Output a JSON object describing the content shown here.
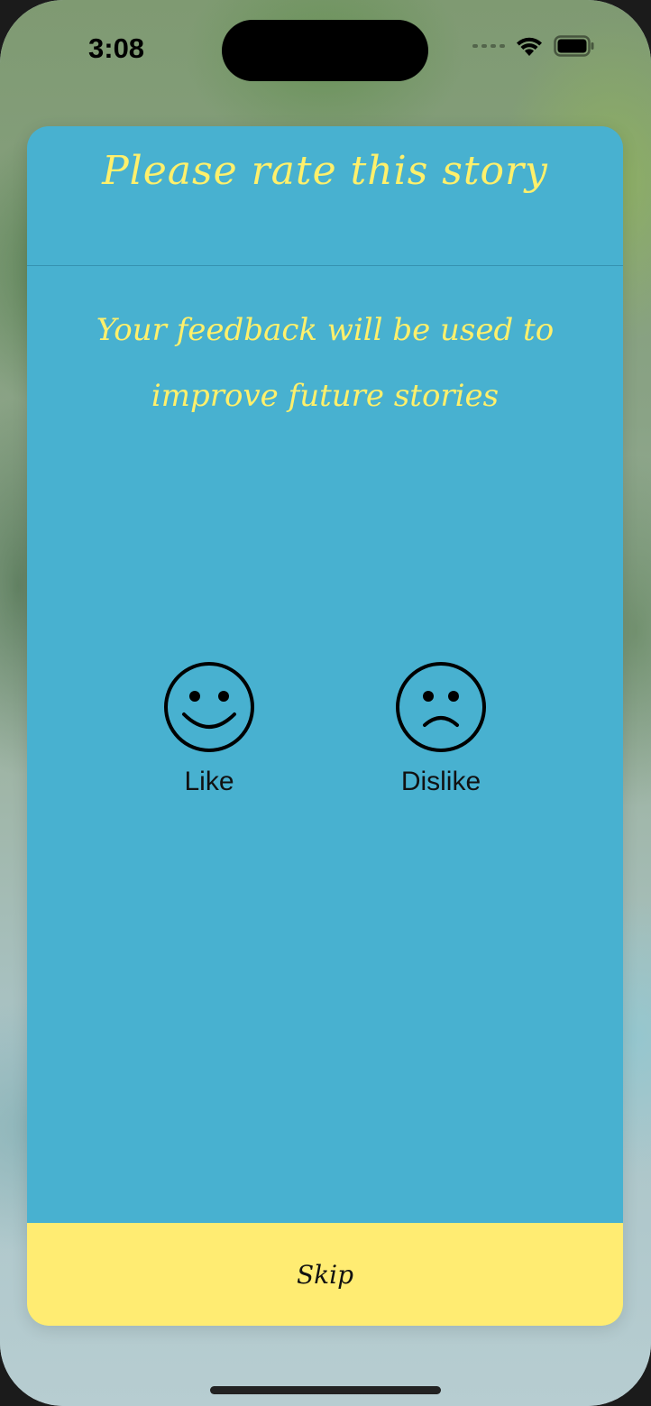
{
  "status_bar": {
    "time": "3:08",
    "icons": [
      "cellular-signal-icon",
      "wifi-icon",
      "battery-icon"
    ]
  },
  "dialog": {
    "title": "Please rate this story",
    "subtitle": "Your feedback will be used to improve future stories",
    "options": [
      {
        "label": "Like",
        "icon": "smiley-face-icon"
      },
      {
        "label": "Dislike",
        "icon": "sad-face-icon"
      }
    ],
    "skip_label": "Skip"
  },
  "colors": {
    "card_background": "#48b1d0",
    "title_text": "#fff06b",
    "skip_background": "#ffec72"
  }
}
